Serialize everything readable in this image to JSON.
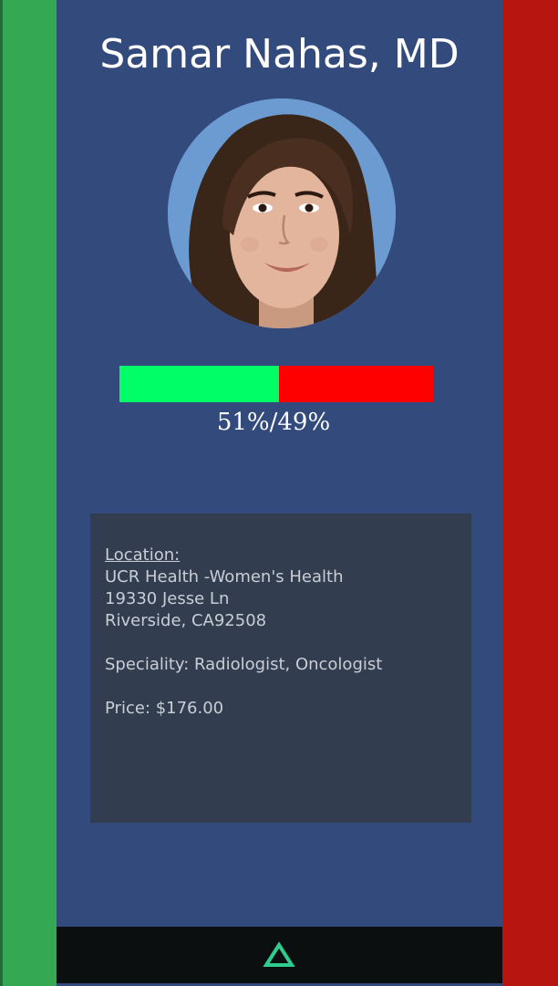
{
  "profile": {
    "name": "Samar Nahas, MD",
    "photo_icon": "doctor-portrait"
  },
  "rating": {
    "positive_fraction": 0.51,
    "negative_fraction": 0.49,
    "positive_color": "#00ff66",
    "negative_color": "#ff0000",
    "label": "51%/49%"
  },
  "details": {
    "location_label": "Location:",
    "address_line1": "UCR Health -Women's Health",
    "address_line2": "19330 Jesse Ln",
    "address_line3": "Riverside, CA92508",
    "speciality": "Speciality: Radiologist, Oncologist",
    "price": "Price: $176.00"
  },
  "colors": {
    "left_panel": "#34a853",
    "right_panel": "#b71510",
    "center_panel": "#334a7d",
    "card": "#323d4f",
    "bottom_bar": "#0b0f0f",
    "up_icon": "#2ecc8f"
  },
  "bottom_bar": {
    "icon": "triangle-up-icon"
  }
}
